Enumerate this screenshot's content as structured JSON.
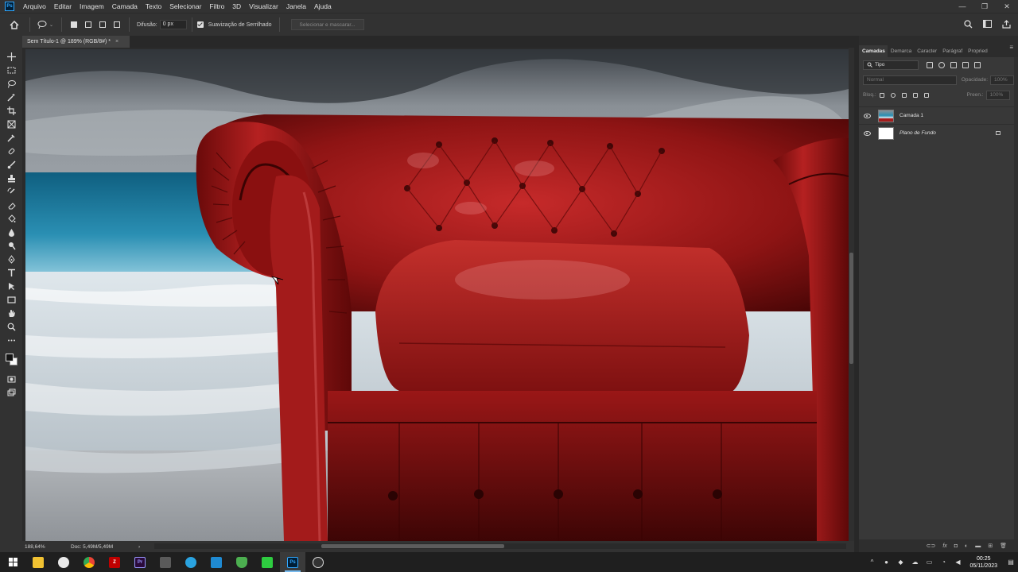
{
  "app": {
    "logo": "Ps",
    "menu": [
      "Arquivo",
      "Editar",
      "Imagem",
      "Camada",
      "Texto",
      "Selecionar",
      "Filtro",
      "3D",
      "Visualizar",
      "Janela",
      "Ajuda"
    ],
    "window_controls": [
      "—",
      "❐",
      "✕"
    ]
  },
  "options_bar": {
    "difusao_label": "Difusão:",
    "difusao_value": "0 px",
    "suavizacao_label": "Suavização de Serrilhado",
    "suavizacao_checked": true,
    "select_mask_button": "Selecionar e mascarar..."
  },
  "document": {
    "tab_title": "Sem Título-1 @ 189% (RGB/8#) *",
    "close": "×"
  },
  "status_bar": {
    "zoom": "188,64%",
    "doc_info": "Doc: 5,49M/5,49M",
    "arrow": "›"
  },
  "layers_panel": {
    "tabs": [
      "Camadas",
      "Demarca",
      "Caracter",
      "Parágraf",
      "Propried"
    ],
    "active_tab": "Camadas",
    "filter_kind": "Tipo",
    "blend_mode": "Normal",
    "opacity_label": "Opacidade:",
    "opacity_value": "100%",
    "lock_label": "Bloq.:",
    "fill_label": "Preen.:",
    "fill_value": "100%",
    "layers": [
      {
        "name": "Camada 1",
        "visible": true,
        "italic": false
      },
      {
        "name": "Plano de Fundo",
        "visible": true,
        "italic": true,
        "locked": true
      }
    ],
    "bottom_icons": [
      "link-icon",
      "fx-icon",
      "mask-icon",
      "adjustment-icon",
      "group-icon",
      "new-layer-icon",
      "trash-icon"
    ],
    "fx_label": "fx"
  },
  "taskbar": {
    "apps": [
      "file-explorer",
      "edge",
      "chrome",
      "filezilla",
      "premiere",
      "calculator",
      "telegram",
      "vscode",
      "vpn",
      "green-app",
      "photoshop",
      "obs"
    ],
    "active_app": "photoshop",
    "time": "00:25",
    "date": "05/11/2023",
    "tray_chevron": "^"
  },
  "colors": {
    "ui_dark": "#323232",
    "panel": "#383838",
    "accent_blue": "#31a8ff",
    "sofa_red": "#a51c1c",
    "sea": "#1d7a9e"
  }
}
